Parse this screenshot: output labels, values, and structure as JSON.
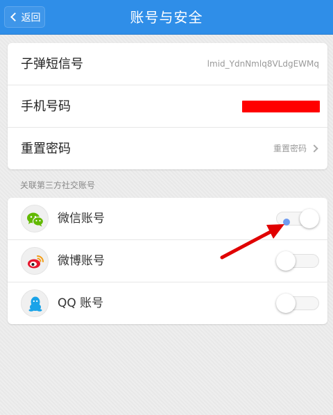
{
  "header": {
    "back_label": "返回",
    "title": "账号与安全"
  },
  "account": {
    "rows": [
      {
        "label": "子弹短信号",
        "value": "lmid_YdnNmlq8VLdgEWMq"
      },
      {
        "label": "手机号码",
        "value": ""
      },
      {
        "label": "重置密码",
        "value": "重置密码"
      }
    ]
  },
  "social": {
    "section_label": "关联第三方社交账号",
    "items": [
      {
        "label": "微信账号",
        "icon": "wechat-icon",
        "enabled": true
      },
      {
        "label": "微博账号",
        "icon": "weibo-icon",
        "enabled": false
      },
      {
        "label": "QQ 账号",
        "icon": "qq-icon",
        "enabled": false
      }
    ]
  },
  "colors": {
    "header": "#2f8ee8",
    "wechat": "#62b900",
    "weibo": "#e6162d",
    "qq": "#1aa3e8",
    "redaction": "#ff0000",
    "annotation": "#e00000"
  }
}
